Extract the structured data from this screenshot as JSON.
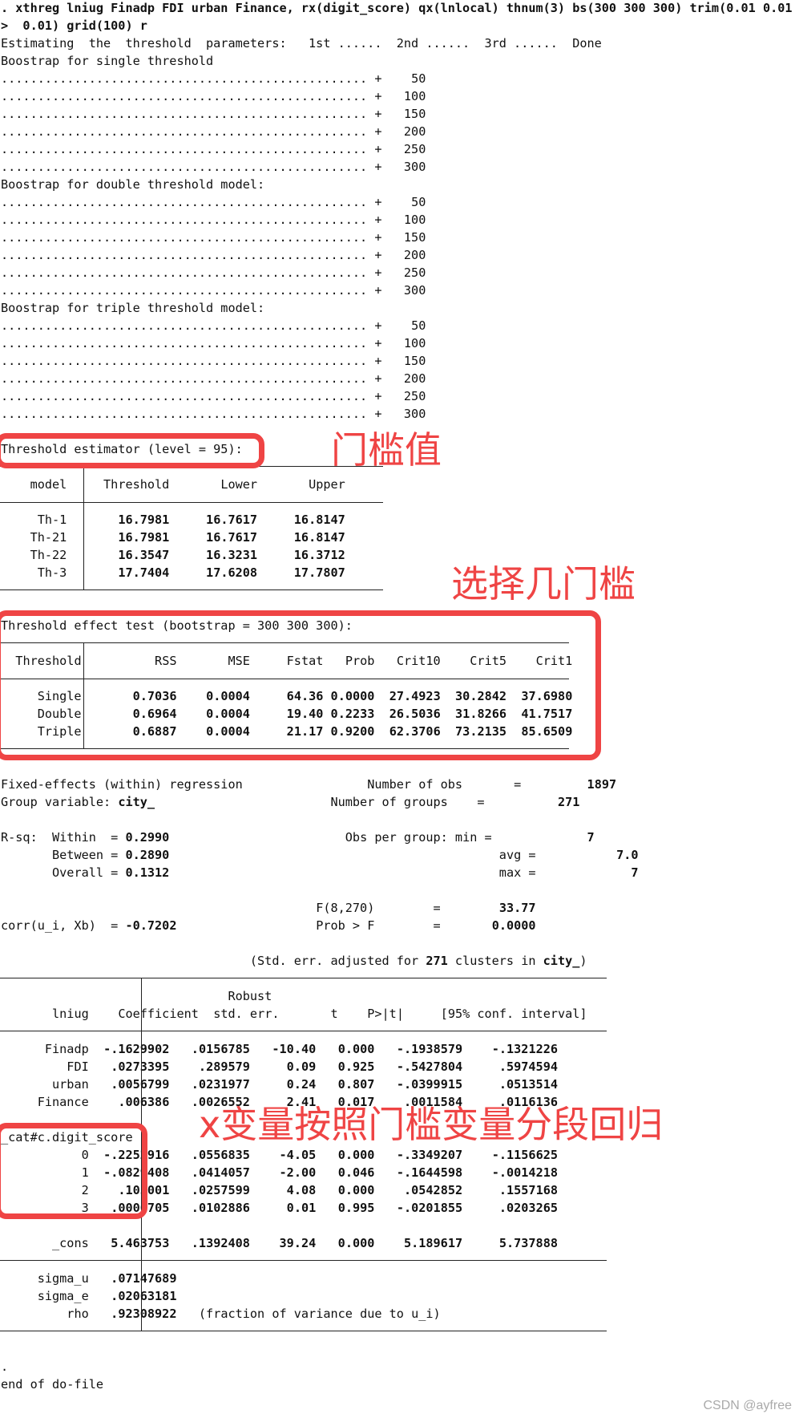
{
  "command": {
    "line1": ". xthreg lniug Finadp FDI urban Finance, rx(digit_score) qx(lnlocal) thnum(3) bs(300 300 300) trim(0.01 0.01",
    "line2": ">  0.01) grid(100) r"
  },
  "progress": {
    "estimating": "Estimating  the  threshold  parameters:   1st ......  2nd ......  3rd ......  Done",
    "dots": "..................................................",
    "sections": [
      {
        "title": "Boostrap for single threshold",
        "steps": [
          "50",
          "100",
          "150",
          "200",
          "250",
          "300"
        ]
      },
      {
        "title": "Boostrap for double threshold model:",
        "steps": [
          "50",
          "100",
          "150",
          "200",
          "250",
          "300"
        ]
      },
      {
        "title": "Boostrap for triple threshold model:",
        "steps": [
          "50",
          "100",
          "150",
          "200",
          "250",
          "300"
        ]
      }
    ]
  },
  "threshold_estimator": {
    "title": "Threshold estimator (level = 95):",
    "headers": [
      "model",
      "Threshold",
      "Lower",
      "Upper"
    ],
    "rows": [
      [
        "Th-1",
        "16.7981",
        "16.7617",
        "16.8147"
      ],
      [
        "Th-21",
        "16.7981",
        "16.7617",
        "16.8147"
      ],
      [
        "Th-22",
        "16.3547",
        "16.3231",
        "16.3712"
      ],
      [
        "Th-3",
        "17.7404",
        "17.6208",
        "17.7807"
      ]
    ]
  },
  "effect_test": {
    "title": "Threshold effect test (bootstrap = 300 300 300):",
    "headers": [
      "Threshold",
      "RSS",
      "MSE",
      "Fstat",
      "Prob",
      "Crit10",
      "Crit5",
      "Crit1"
    ],
    "rows": [
      [
        "Single",
        "0.7036",
        "0.0004",
        "64.36",
        "0.0000",
        "27.4923",
        "30.2842",
        "37.6980"
      ],
      [
        "Double",
        "0.6964",
        "0.0004",
        "19.40",
        "0.2233",
        "26.5036",
        "31.8266",
        "41.7517"
      ],
      [
        "Triple",
        "0.6887",
        "0.0004",
        "21.17",
        "0.9200",
        "62.3706",
        "73.2135",
        "85.6509"
      ]
    ]
  },
  "regression_header": {
    "title": "Fixed-effects (within) regression",
    "group_label": "Group variable: ",
    "group_var": "city_",
    "nobs_label": "Number of obs",
    "nobs": "1897",
    "ngroups_label": "Number of groups",
    "ngroups": "271",
    "rsq_label": "R-sq:",
    "within_label": "Within  = ",
    "within": "0.2990",
    "between_label": "Between = ",
    "between": "0.2890",
    "overall_label": "Overall = ",
    "overall": "0.1312",
    "obs_per_group_label": "Obs per group: min =",
    "min": "7",
    "avg_label": "avg =",
    "avg": "7.0",
    "max_label": "max =",
    "max": "7",
    "f_label": "F(8,270)",
    "f_value": "33.77",
    "probf_label": "Prob > F",
    "probf_value": "0.0000",
    "corr_label": "corr(u_i, Xb)  = ",
    "corr_value": "-0.7202",
    "eq": "=",
    "cluster_pre": "(Std. err. adjusted for ",
    "cluster_n": "271",
    "cluster_mid": " clusters in ",
    "cluster_var": "city_",
    "cluster_post": ")"
  },
  "coef_table": {
    "depvar": "lniug",
    "robust": "Robust",
    "headers": [
      "Coefficient",
      "std. err.",
      "t",
      "P>|t|",
      "[95% conf. interval]"
    ],
    "rows": [
      [
        "Finadp",
        "-.1629902",
        ".0156785",
        "-10.40",
        "0.000",
        "-.1938579",
        "-.1321226"
      ],
      [
        "FDI",
        ".0273395",
        ".289579",
        "0.09",
        "0.925",
        "-.5427804",
        ".5974594"
      ],
      [
        "urban",
        ".0056799",
        ".0231977",
        "0.24",
        "0.807",
        "-.0399915",
        ".0513514"
      ],
      [
        "Finance",
        ".006386",
        ".0026552",
        "2.41",
        "0.017",
        ".0011584",
        ".0116136"
      ]
    ],
    "group_label": "_cat#c.digit_score",
    "cat_rows": [
      [
        "0",
        "-.2252916",
        ".0556835",
        "-4.05",
        "0.000",
        "-.3349207",
        "-.1156625"
      ],
      [
        "1",
        "-.0829408",
        ".0414057",
        "-2.00",
        "0.046",
        "-.1644598",
        "-.0014218"
      ],
      [
        "2",
        ".105001",
        ".0257599",
        "4.08",
        "0.000",
        ".0542852",
        ".1557168"
      ],
      [
        "3",
        ".0000705",
        ".0102886",
        "0.01",
        "0.995",
        "-.0201855",
        ".0203265"
      ]
    ],
    "cons": [
      "_cons",
      "5.463753",
      ".1392408",
      "39.24",
      "0.000",
      "5.189617",
      "5.737888"
    ],
    "sigma_u_label": "sigma_u",
    "sigma_u": ".07147689",
    "sigma_e_label": "sigma_e",
    "sigma_e": ".02063181",
    "rho_label": "rho",
    "rho": ".92308922",
    "rho_note": "(fraction of variance due to u_i)"
  },
  "footer": {
    "dot": ".",
    "end": "end of do-file"
  },
  "annotations": {
    "threshold_value": "门槛值",
    "choose_threshold": "选择几门槛",
    "piecewise": "x变量按照门槛变量分段回归",
    "color": "#ef4444"
  },
  "watermark": "CSDN @ayfree"
}
